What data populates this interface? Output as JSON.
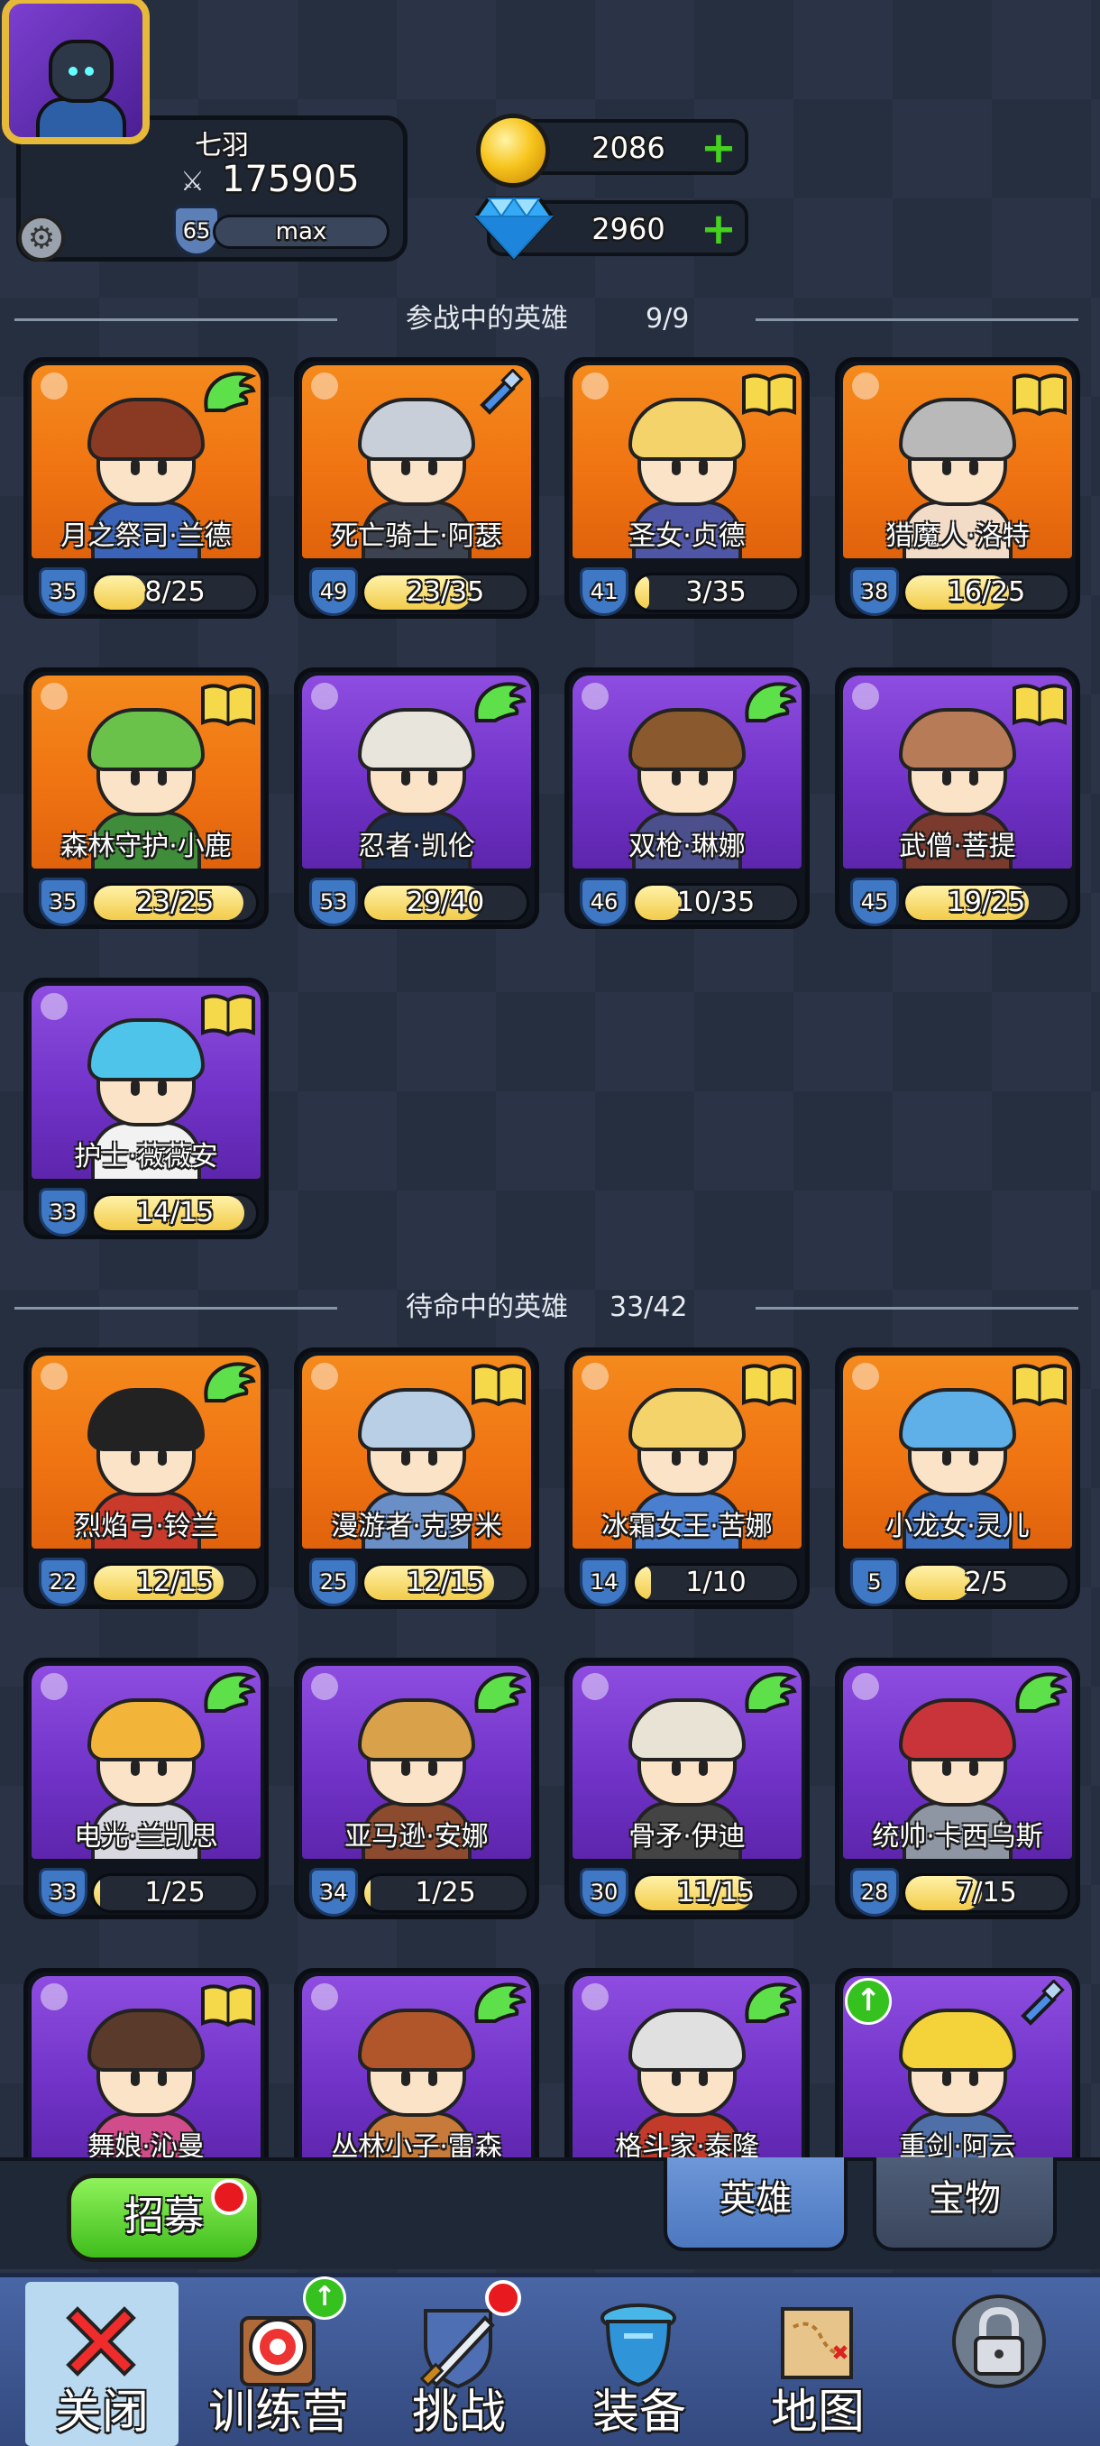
{
  "player": {
    "name": "七羽",
    "power": "175905",
    "level": "65",
    "xp_label": "max"
  },
  "currency": {
    "gold": "2086",
    "gems": "2960"
  },
  "active": {
    "title": "参战中的英雄",
    "count": "9/9"
  },
  "standby": {
    "title": "待命中的英雄",
    "count": "33/42"
  },
  "heroes_active": [
    {
      "name": "月之祭司·兰德",
      "level": "35",
      "fragments": "8/25",
      "progress": 0.32,
      "bg": "orange",
      "badge": "wing",
      "hair": "#8a3a22",
      "outfit": "#3b64b8"
    },
    {
      "name": "死亡骑士·阿瑟",
      "level": "49",
      "fragments": "23/35",
      "progress": 0.66,
      "bg": "orange",
      "badge": "potion",
      "hair": "#c9cfd8",
      "outfit": "#3d4250"
    },
    {
      "name": "圣女·贞德",
      "level": "41",
      "fragments": "3/35",
      "progress": 0.09,
      "bg": "orange",
      "badge": "book",
      "hair": "#f3d36a",
      "outfit": "#4f56a6"
    },
    {
      "name": "猎魔人·洛特",
      "level": "38",
      "fragments": "16/25",
      "progress": 0.64,
      "bg": "orange",
      "badge": "book",
      "hair": "#b9b9b9",
      "outfit": "#f2dcc8"
    },
    {
      "name": "森林守护·小鹿",
      "level": "35",
      "fragments": "23/25",
      "progress": 0.92,
      "bg": "orange",
      "badge": "book",
      "hair": "#6bc24a",
      "outfit": "#3f8d3a"
    },
    {
      "name": "忍者·凯伦",
      "level": "53",
      "fragments": "29/40",
      "progress": 0.73,
      "bg": "purple",
      "badge": "wing",
      "hair": "#e8e6dc",
      "outfit": "#1f2d4a"
    },
    {
      "name": "双枪·琳娜",
      "level": "46",
      "fragments": "10/35",
      "progress": 0.29,
      "bg": "purple",
      "badge": "wing",
      "hair": "#8a5a2e",
      "outfit": "#4b4f8c"
    },
    {
      "name": "武僧·菩提",
      "level": "45",
      "fragments": "19/25",
      "progress": 0.76,
      "bg": "purple",
      "badge": "book",
      "hair": "#b77b58",
      "outfit": "#7a3b2e"
    },
    {
      "name": "护士·薇薇安",
      "level": "33",
      "fragments": "14/15",
      "progress": 0.93,
      "bg": "purple",
      "badge": "book",
      "hair": "#4fc4ea",
      "outfit": "#f2f2f2"
    }
  ],
  "heroes_standby": [
    {
      "name": "烈焰弓·铃兰",
      "level": "22",
      "fragments": "12/15",
      "progress": 0.8,
      "bg": "orange",
      "badge": "wing",
      "hair": "#222222",
      "outfit": "#c93a2b"
    },
    {
      "name": "漫游者·克罗米",
      "level": "25",
      "fragments": "12/15",
      "progress": 0.8,
      "bg": "orange",
      "badge": "book",
      "hair": "#b8cfe6",
      "outfit": "#6a8fc7"
    },
    {
      "name": "冰霜女王·苦娜",
      "level": "14",
      "fragments": "1/10",
      "progress": 0.1,
      "bg": "orange",
      "badge": "book",
      "hair": "#f3d36a",
      "outfit": "#4a7fd0"
    },
    {
      "name": "小龙女·灵儿",
      "level": "5",
      "fragments": "2/5",
      "progress": 0.4,
      "bg": "orange",
      "badge": "book",
      "hair": "#5fb0e8",
      "outfit": "#3d6fbf"
    },
    {
      "name": "电光·兰凯思",
      "level": "33",
      "fragments": "1/25",
      "progress": 0.04,
      "bg": "purple",
      "badge": "wing",
      "hair": "#f3b43a",
      "outfit": "#d8d8e0"
    },
    {
      "name": "亚马逊·安娜",
      "level": "34",
      "fragments": "1/25",
      "progress": 0.04,
      "bg": "purple",
      "badge": "wing",
      "hair": "#d9a14a",
      "outfit": "#8c4a2e"
    },
    {
      "name": "骨矛·伊迪",
      "level": "30",
      "fragments": "11/15",
      "progress": 0.73,
      "bg": "purple",
      "badge": "wing",
      "hair": "#e9e3d6",
      "outfit": "#444444"
    },
    {
      "name": "统帅·卡西乌斯",
      "level": "28",
      "fragments": "7/15",
      "progress": 0.47,
      "bg": "purple",
      "badge": "wing",
      "hair": "#c8343a",
      "outfit": "#8f96a3"
    },
    {
      "name": "舞娘·沁曼",
      "level": "",
      "fragments": "",
      "progress": 0,
      "bg": "purple",
      "badge": "book",
      "hair": "#5a3a2a",
      "outfit": "#d04c8a"
    },
    {
      "name": "丛林小子·雷森",
      "level": "",
      "fragments": "",
      "progress": 0,
      "bg": "purple",
      "badge": "wing",
      "hair": "#b0562a",
      "outfit": "#c77a3a"
    },
    {
      "name": "格斗家·泰隆",
      "level": "",
      "fragments": "",
      "progress": 0,
      "bg": "purple",
      "badge": "wing",
      "hair": "#e0e0e0",
      "outfit": "#c23a2a"
    },
    {
      "name": "重剑·阿云",
      "level": "",
      "fragments": "",
      "progress": 0,
      "bg": "purple",
      "badge": "potion",
      "hair": "#f4d23a",
      "outfit": "#4f6fa8",
      "upgrade": true
    }
  ],
  "buttons": {
    "recruit": "招募",
    "tab_heroes": "英雄",
    "tab_treasure": "宝物"
  },
  "nav": {
    "close": "关闭",
    "camp": "训练营",
    "challenge": "挑战",
    "equip": "装备",
    "map": "地图"
  }
}
